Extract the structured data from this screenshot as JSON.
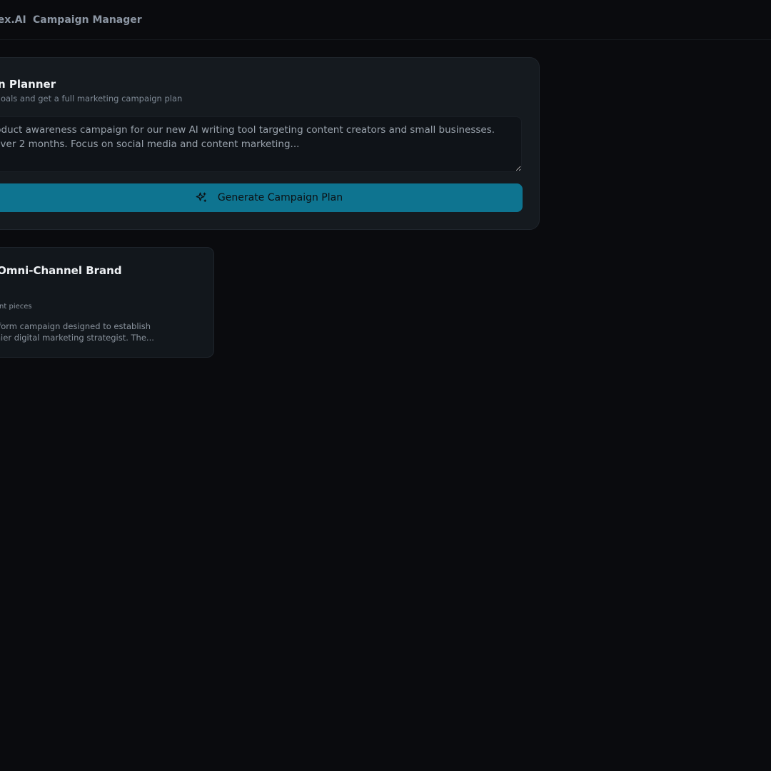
{
  "app": {
    "brand": "lex.AI",
    "nav_label": "Campaign Manager"
  },
  "planner": {
    "title": "aign Planner",
    "subtitle": "our goals and get a full marketing campaign plan",
    "input_value": "roduct awareness campaign for our new AI writing tool targeting content creators and small businesses.\n over 2 months. Focus on social media and content marketing...",
    "generate_label": "Generate Campaign Plan",
    "generate_icon": "sparkles-icon"
  },
  "campaigns": [
    {
      "title": "ex Omni-Channel Brand",
      "meta": "content pieces",
      "description_line1": "-platform campaign designed to establish",
      "description_line2": "premier digital marketing strategist. The..."
    }
  ],
  "colors": {
    "background": "#0a0b0e",
    "card": "#151a1f",
    "accent": "#0e7490",
    "text_primary": "#eef1f4",
    "text_muted": "#8a939d"
  }
}
